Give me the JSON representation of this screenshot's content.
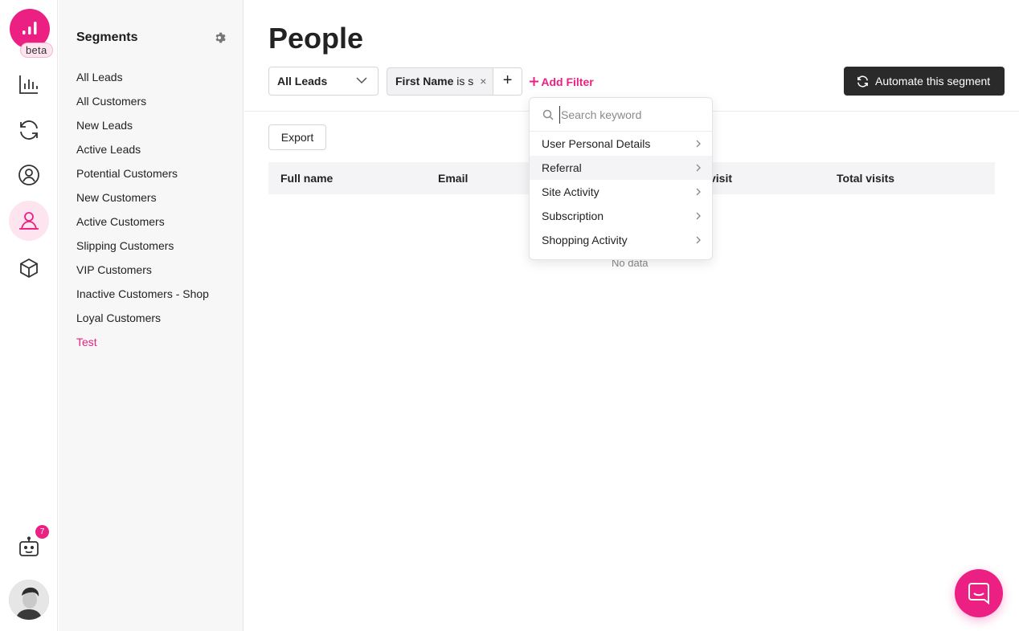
{
  "rail": {
    "beta_label": "beta",
    "notification_count": "7",
    "brand_color": "#ec1f83",
    "icons": [
      "analytics-icon",
      "automation-sync-icon",
      "contacts-icon",
      "people-icon",
      "products-cube-icon",
      "bot-icon"
    ]
  },
  "sidebar": {
    "title": "Segments",
    "items": [
      {
        "label": "All Leads"
      },
      {
        "label": "All Customers"
      },
      {
        "label": "New Leads"
      },
      {
        "label": "Active Leads"
      },
      {
        "label": "Potential Customers"
      },
      {
        "label": "New Customers"
      },
      {
        "label": "Active Customers"
      },
      {
        "label": "Slipping Customers"
      },
      {
        "label": "VIP Customers"
      },
      {
        "label": "Inactive Customers - Shop"
      },
      {
        "label": "Loyal Customers"
      },
      {
        "label": "Test"
      }
    ],
    "active_item": "Test"
  },
  "main": {
    "title": "People",
    "segment_select": "All Leads",
    "filter_chip": {
      "field": "First Name",
      "rest": " is s"
    },
    "filter_chip_remove": "×",
    "filter_add_plus": "+",
    "add_filter_label": "Add Filter",
    "automate_label": "Automate this segment",
    "export_label": "Export",
    "columns": [
      "Full name",
      "Email",
      "visit",
      "Total visits"
    ],
    "no_data": "No data"
  },
  "dropdown": {
    "search_placeholder": "Search keyword",
    "items": [
      {
        "label": "User Personal Details"
      },
      {
        "label": "Referral"
      },
      {
        "label": "Site Activity"
      },
      {
        "label": "Subscription"
      },
      {
        "label": "Shopping Activity"
      }
    ],
    "highlighted_item": "Referral"
  }
}
